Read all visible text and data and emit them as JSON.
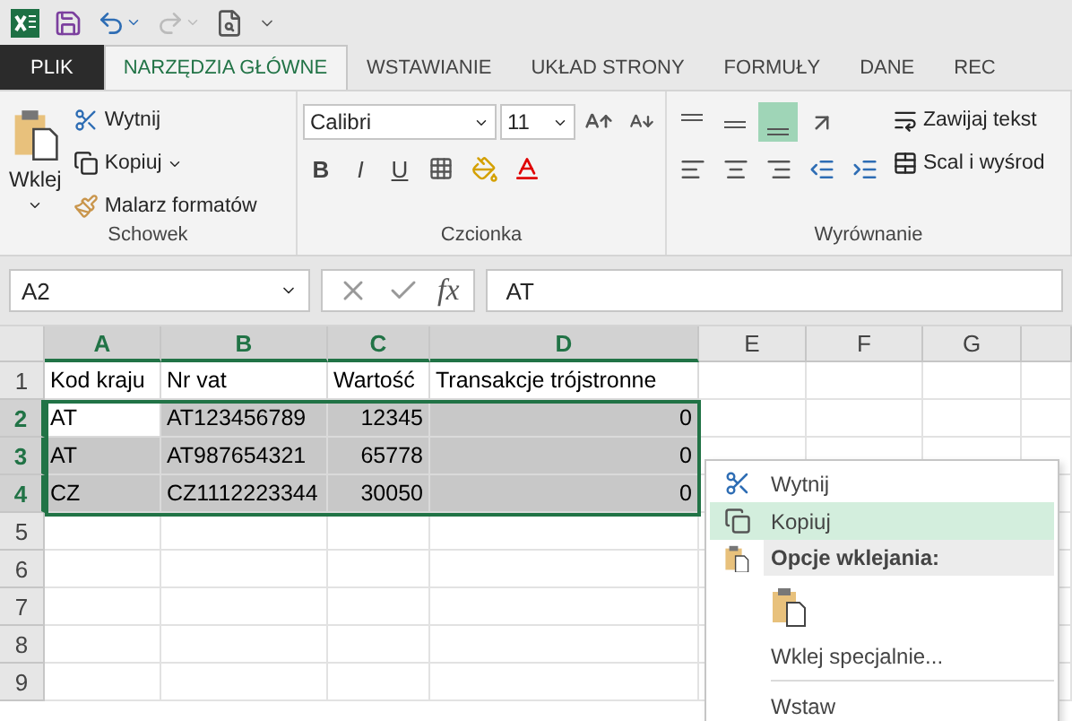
{
  "quick_access": {
    "redo_disabled": true
  },
  "tabs": [
    {
      "label": "PLIK",
      "kind": "file",
      "selected": false
    },
    {
      "label": "NARZĘDZIA GŁÓWNE",
      "kind": "tab",
      "selected": true
    },
    {
      "label": "WSTAWIANIE",
      "kind": "tab",
      "selected": false
    },
    {
      "label": "UKŁAD STRONY",
      "kind": "tab",
      "selected": false
    },
    {
      "label": "FORMUŁY",
      "kind": "tab",
      "selected": false
    },
    {
      "label": "DANE",
      "kind": "tab",
      "selected": false
    },
    {
      "label": "REC",
      "kind": "tab",
      "selected": false
    }
  ],
  "ribbon": {
    "clipboard": {
      "paste": "Wklej",
      "cut": "Wytnij",
      "copy": "Kopiuj",
      "painter": "Malarz formatów",
      "label": "Schowek"
    },
    "font": {
      "name": "Calibri",
      "size": "11",
      "bold": "B",
      "italic": "I",
      "underline": "U",
      "label": "Czcionka"
    },
    "alignment": {
      "vertical": [
        {
          "kind": "top",
          "selected": false
        },
        {
          "kind": "middle",
          "selected": false
        },
        {
          "kind": "bottom",
          "selected": true
        }
      ],
      "wrap": "Zawijaj tekst",
      "merge": "Scal i wyśrod",
      "label": "Wyrównanie"
    }
  },
  "formula_bar": {
    "name_box": "A2",
    "fx": "fx",
    "value": "AT"
  },
  "sheet": {
    "columns": [
      {
        "label": "A",
        "selected": true
      },
      {
        "label": "B",
        "selected": true
      },
      {
        "label": "C",
        "selected": true
      },
      {
        "label": "D",
        "selected": true
      },
      {
        "label": "E",
        "selected": false
      },
      {
        "label": "F",
        "selected": false
      },
      {
        "label": "G",
        "selected": false
      }
    ],
    "rows": [
      {
        "label": "1",
        "selected": false,
        "cells": [
          {
            "text": "Kod kraju",
            "kind": "text",
            "selected": false,
            "active": false
          },
          {
            "text": "Nr vat",
            "kind": "text",
            "selected": false,
            "active": false
          },
          {
            "text": "Wartość",
            "kind": "text",
            "selected": false,
            "active": false
          },
          {
            "text": "Transakcje trójstronne",
            "kind": "text",
            "selected": false,
            "active": false
          }
        ]
      },
      {
        "label": "2",
        "selected": true,
        "cells": [
          {
            "text": "AT",
            "kind": "text",
            "selected": true,
            "active": true
          },
          {
            "text": "AT123456789",
            "kind": "text",
            "selected": true,
            "active": false
          },
          {
            "text": "12345",
            "kind": "number",
            "selected": true,
            "active": false
          },
          {
            "text": "0",
            "kind": "number",
            "selected": true,
            "active": false
          }
        ]
      },
      {
        "label": "3",
        "selected": true,
        "cells": [
          {
            "text": "AT",
            "kind": "text",
            "selected": true,
            "active": false
          },
          {
            "text": "AT987654321",
            "kind": "text",
            "selected": true,
            "active": false
          },
          {
            "text": "65778",
            "kind": "number",
            "selected": true,
            "active": false
          },
          {
            "text": "0",
            "kind": "number",
            "selected": true,
            "active": false
          }
        ]
      },
      {
        "label": "4",
        "selected": true,
        "cells": [
          {
            "text": "CZ",
            "kind": "text",
            "selected": true,
            "active": false
          },
          {
            "text": "CZ1112223344",
            "kind": "text",
            "selected": true,
            "active": false
          },
          {
            "text": "30050",
            "kind": "number",
            "selected": true,
            "active": false
          },
          {
            "text": "0",
            "kind": "number",
            "selected": true,
            "active": false
          }
        ]
      },
      {
        "label": "5",
        "selected": false,
        "cells": []
      },
      {
        "label": "6",
        "selected": false,
        "cells": []
      },
      {
        "label": "7",
        "selected": false,
        "cells": []
      },
      {
        "label": "8",
        "selected": false,
        "cells": []
      },
      {
        "label": "9",
        "selected": false,
        "cells": []
      }
    ]
  },
  "context_menu": [
    {
      "kind": "cut",
      "label": "Wytnij",
      "selected": false
    },
    {
      "kind": "copy",
      "label": "Kopiuj",
      "selected": true
    },
    {
      "kind": "header",
      "label": "Opcje wklejania:",
      "selected": false
    },
    {
      "kind": "paste-option",
      "selected": false
    },
    {
      "kind": "plain",
      "label": "Wklej specjalnie...",
      "selected": false
    },
    {
      "kind": "separator"
    },
    {
      "kind": "plain",
      "label": "Wstaw",
      "selected": false
    }
  ]
}
